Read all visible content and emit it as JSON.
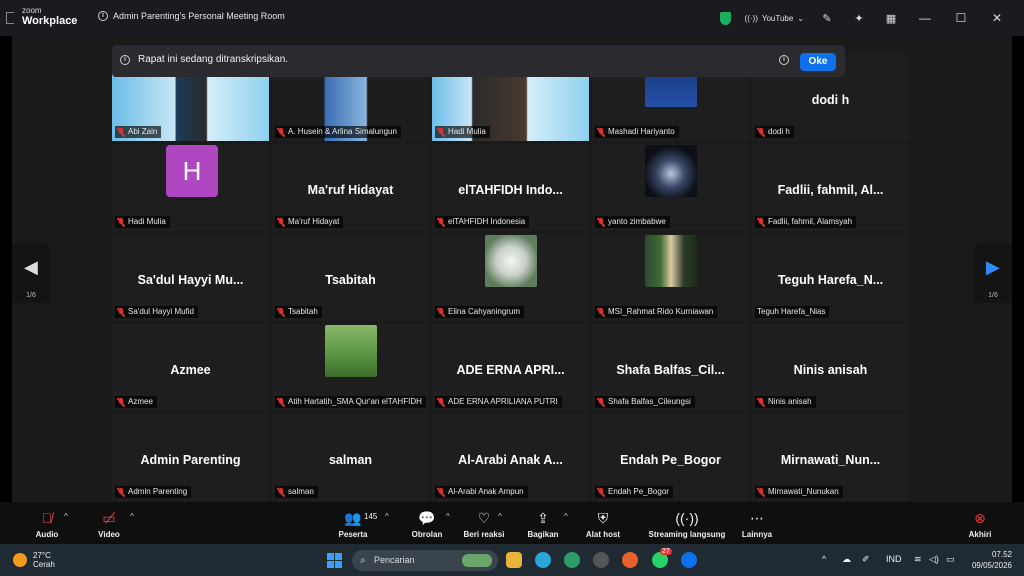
{
  "titlebar": {
    "logo_line1": "zoom",
    "logo_line2": "Workplace",
    "meeting_title": "Admin Parenting's Personal Meeting Room",
    "youtube_label": "YouTube",
    "icons": [
      "shield-icon",
      "youtube-live-icon",
      "pencil-icon",
      "sparkle-icon",
      "grid-icon",
      "minimize-icon",
      "maximize-icon",
      "close-icon"
    ]
  },
  "banner": {
    "message": "Rapat ini sedang ditranskripsikan.",
    "ok_label": "Oke"
  },
  "nav": {
    "prev_page": "1/6",
    "next_page": "1/6"
  },
  "tiles": [
    {
      "label": "Abi Zain",
      "display": "video",
      "active": true
    },
    {
      "label": "A. Husein & Arlina Simalungun",
      "display": "video"
    },
    {
      "label": "Hadi Mulia",
      "display": "video"
    },
    {
      "label": "Mashadi Hariyanto",
      "display": "photo"
    },
    {
      "label": "dodi h",
      "big": "dodi h"
    },
    {
      "label": "Hadi Mulia",
      "display": "avatar",
      "avatar_letter": "H",
      "avatar_color": "#b146c2"
    },
    {
      "label": "Ma'ruf Hidayat",
      "big": "Ma'ruf Hidayat"
    },
    {
      "label": "elTAHFIDH Indonesia",
      "big": "elTAHFIDH  Indo..."
    },
    {
      "label": "yanto zimbabwe",
      "display": "photo"
    },
    {
      "label": "Fadlii, fahmil, Alamsyah",
      "big": "Fadlii,  fahmil,  Al..."
    },
    {
      "label": "Sa'dul Hayyi Mufid",
      "big": "Sa'dul  Hayyi  Mu..."
    },
    {
      "label": "Tsabitah",
      "big": "Tsabitah"
    },
    {
      "label": "Elina Cahyaningrum",
      "display": "photo"
    },
    {
      "label": "MSI_Rahmat Rido Kurniawan",
      "display": "photo"
    },
    {
      "label": "Teguh Harefa_Nias",
      "big": "Teguh  Harefa_N...",
      "muted": false
    },
    {
      "label": "Azmee",
      "big": "Azmee"
    },
    {
      "label": "Atih Hartatih_SMA Qur'an elTAHFIDH",
      "display": "photo"
    },
    {
      "label": "ADE ERNA APRILIANA PUTRI",
      "big": "ADE  ERNA  APRI..."
    },
    {
      "label": "Shafa Balfas_Cileungsi",
      "big": "Shafa  Balfas_Cil..."
    },
    {
      "label": "Ninis anisah",
      "big": "Ninis  anisah"
    },
    {
      "label": "Admin Parenting",
      "big": "Admin  Parenting"
    },
    {
      "label": "salman",
      "big": "salman"
    },
    {
      "label": "Al-Arabi Anak Ampun",
      "big": "Al-Arabi  Anak  A..."
    },
    {
      "label": "Endah Pe_Bogor",
      "big": "Endah  Pe_Bogor"
    },
    {
      "label": "Mirnawati_Nunukan",
      "big": "Mirnawati_Nun..."
    }
  ],
  "toolbar": {
    "audio": "Audio",
    "video": "Video",
    "participants": "Peserta",
    "participants_count": "145",
    "chat": "Obrolan",
    "react": "Beri reaksi",
    "share": "Bagikan",
    "host_tools": "Alat host",
    "streaming": "Streaming langsung",
    "more": "Lainnya",
    "leave": "Akhiri"
  },
  "taskbar": {
    "temperature": "27°C",
    "weather": "Cerah",
    "search_placeholder": "Pencarian",
    "whatsapp_badge": "27",
    "language": "IND",
    "time": "07.52",
    "date": "09/05/2026"
  }
}
